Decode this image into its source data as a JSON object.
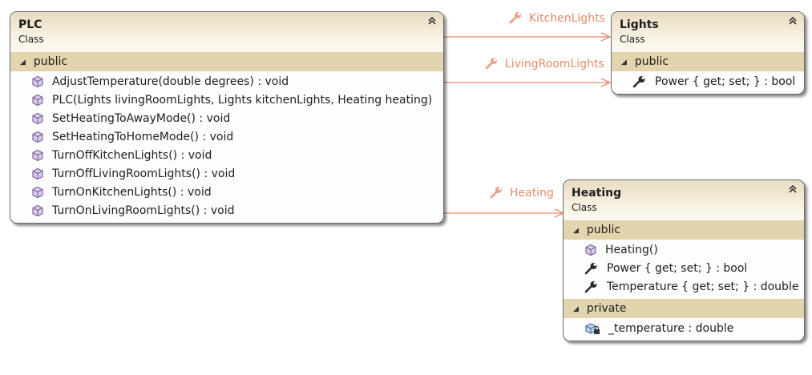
{
  "classes": {
    "plc": {
      "name": "PLC",
      "kind": "Class",
      "sections": [
        {
          "title": "public",
          "members": [
            {
              "icon": "method-icon",
              "text": "AdjustTemperature(double degrees) : void"
            },
            {
              "icon": "method-icon",
              "text": "PLC(Lights livingRoomLights, Lights kitchenLights, Heating heating)"
            },
            {
              "icon": "method-icon",
              "text": "SetHeatingToAwayMode() : void"
            },
            {
              "icon": "method-icon",
              "text": "SetHeatingToHomeMode() : void"
            },
            {
              "icon": "method-icon",
              "text": "TurnOffKitchenLights() : void"
            },
            {
              "icon": "method-icon",
              "text": "TurnOffLivingRoomLights() : void"
            },
            {
              "icon": "method-icon",
              "text": "TurnOnKitchenLights() : void"
            },
            {
              "icon": "method-icon",
              "text": "TurnOnLivingRoomLights() : void"
            }
          ]
        }
      ]
    },
    "lights": {
      "name": "Lights",
      "kind": "Class",
      "sections": [
        {
          "title": "public",
          "members": [
            {
              "icon": "property-icon",
              "text": "Power { get; set; } : bool"
            }
          ]
        }
      ]
    },
    "heating": {
      "name": "Heating",
      "kind": "Class",
      "sections": [
        {
          "title": "public",
          "members": [
            {
              "icon": "method-icon",
              "text": "Heating()"
            },
            {
              "icon": "property-icon",
              "text": "Power { get; set; } : bool"
            },
            {
              "icon": "property-icon",
              "text": "Temperature { get; set; } : double"
            }
          ]
        },
        {
          "title": "private",
          "members": [
            {
              "icon": "private-field-icon",
              "text": "_temperature : double"
            }
          ]
        }
      ]
    }
  },
  "associations": {
    "kitchen": "KitchenLights",
    "living": "LivingRoomLights",
    "heating": "Heating"
  },
  "colors": {
    "association_line": "#e58a6a",
    "section_band": "#e2d4ac",
    "method_icon": "#8a6fa8"
  }
}
